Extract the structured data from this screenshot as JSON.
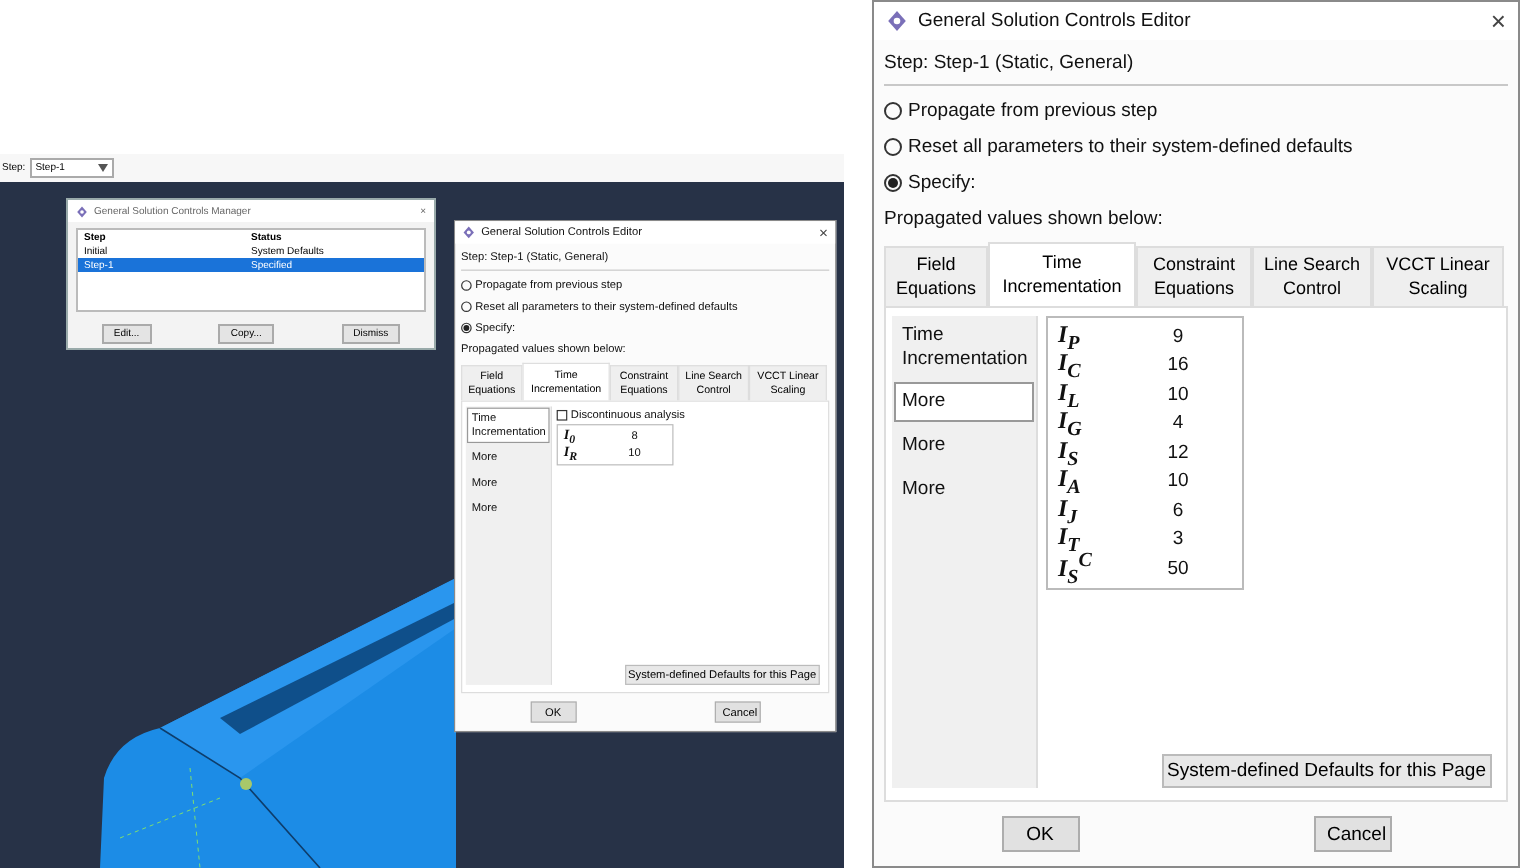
{
  "toolbar": {
    "step_label": "Step:",
    "step_value": "Step-1"
  },
  "manager": {
    "title": "General Solution Controls Manager",
    "close": "×",
    "columns": [
      "Step",
      "Status"
    ],
    "rows": [
      {
        "cells": [
          "Initial",
          "System Defaults"
        ],
        "selected": false
      },
      {
        "cells": [
          "Step-1",
          "Specified"
        ],
        "selected": true
      }
    ],
    "buttons": [
      "Edit...",
      "Copy...",
      "Dismiss"
    ]
  },
  "editors": [
    {
      "kind": "small",
      "title": "General Solution Controls Editor",
      "close": "×",
      "step": "Step:  Step-1 (Static, General)",
      "options": [
        {
          "label": "Propagate from previous step",
          "selected": false
        },
        {
          "label": "Reset all parameters to their system-defined defaults",
          "selected": false
        },
        {
          "label": "Specify:",
          "selected": true
        }
      ],
      "propagated": "Propagated values shown below:",
      "tabs": [
        {
          "label": "Field Equations",
          "selected": false
        },
        {
          "label": "Time Incrementation",
          "selected": true
        },
        {
          "label": "Constraint Equations",
          "selected": false
        },
        {
          "label": "Line Search Control",
          "selected": false
        },
        {
          "label": "VCCT Linear Scaling",
          "selected": false
        }
      ],
      "side_items": [
        {
          "label": "Time Incrementation",
          "selected": true
        },
        {
          "label": "More",
          "selected": false
        },
        {
          "label": "More",
          "selected": false
        },
        {
          "label": "More",
          "selected": false
        }
      ],
      "discontinuous": {
        "label": "Discontinuous analysis",
        "checked": false
      },
      "params": [
        {
          "symbol": "I$_{0}$",
          "value": "8"
        },
        {
          "symbol": "I$_{R}$",
          "value": "10"
        }
      ],
      "defaults_button": "System-defined Defaults for this Page",
      "buttons": [
        "OK",
        "Cancel"
      ]
    },
    {
      "kind": "large",
      "title": "General Solution Controls Editor",
      "close": "×",
      "step": "Step:  Step-1 (Static, General)",
      "options": [
        {
          "label": "Propagate from previous step",
          "selected": false
        },
        {
          "label": "Reset all parameters to their system-defined defaults",
          "selected": false
        },
        {
          "label": "Specify:",
          "selected": true
        }
      ],
      "propagated": "Propagated values shown below:",
      "tabs": [
        {
          "label": "Field Equations",
          "selected": false
        },
        {
          "label": "Time Incrementation",
          "selected": true
        },
        {
          "label": "Constraint Equations",
          "selected": false
        },
        {
          "label": "Line Search Control",
          "selected": false
        },
        {
          "label": "VCCT Linear Scaling",
          "selected": false
        }
      ],
      "side_items": [
        {
          "label": "Time Incrementation",
          "selected": false
        },
        {
          "label": "More",
          "selected": true
        },
        {
          "label": "More",
          "selected": false
        },
        {
          "label": "More",
          "selected": false
        }
      ],
      "params": [
        {
          "symbol": "I$_{P}$",
          "value": "9"
        },
        {
          "symbol": "I$_{C}$",
          "value": "16"
        },
        {
          "symbol": "I$_{L}$",
          "value": "10"
        },
        {
          "symbol": "I$_{G}$",
          "value": "4"
        },
        {
          "symbol": "I$_{S}$",
          "value": "12"
        },
        {
          "symbol": "I$_{A}$",
          "value": "10"
        },
        {
          "symbol": "I$_{J}$",
          "value": "6"
        },
        {
          "symbol": "I$_{T}$",
          "value": "3"
        },
        {
          "symbol": "I$_{S}$$^{C}$",
          "value": "50"
        }
      ],
      "defaults_button": "System-defined Defaults for this Page",
      "buttons": [
        "OK",
        "Cancel"
      ]
    }
  ]
}
